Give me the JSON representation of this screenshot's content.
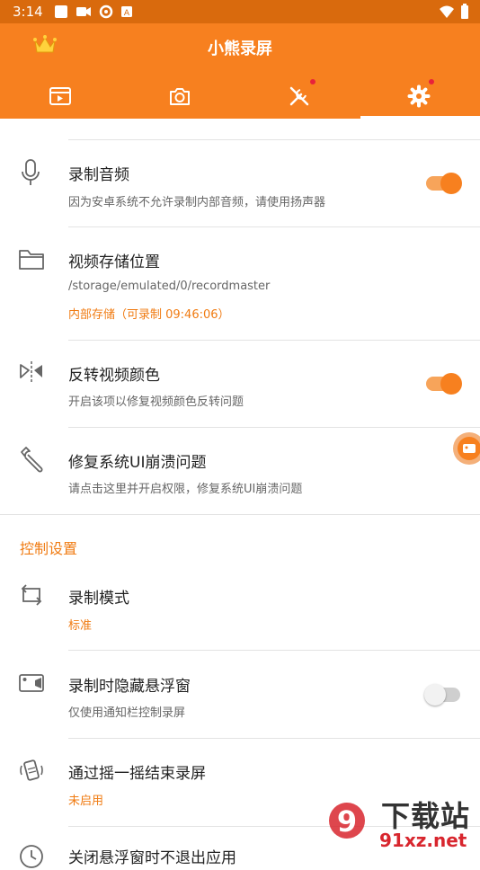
{
  "status_bar": {
    "time": "3:14"
  },
  "app": {
    "title": "小熊录屏"
  },
  "tabs": [
    {
      "icon": "video-list-icon",
      "has_dot": false
    },
    {
      "icon": "camera-icon",
      "has_dot": false
    },
    {
      "icon": "tools-icon",
      "has_dot": true
    },
    {
      "icon": "gear-icon",
      "has_dot": true,
      "selected": true
    }
  ],
  "settings": [
    {
      "icon": "microphone-icon",
      "title": "录制音频",
      "subtitle": "因为安卓系统不允许录制内部音频，请使用扬声器",
      "toggle": true
    },
    {
      "icon": "folder-icon",
      "title": "视频存储位置",
      "subtitle": "/storage/emulated/0/recordmaster",
      "extra": "内部存储（可录制 09:46:06）"
    },
    {
      "icon": "flip-icon",
      "title": "反转视频颜色",
      "subtitle": "开启该项以修复视频颜色反转问题",
      "toggle": true
    },
    {
      "icon": "wrench-icon",
      "title": "修复系统UI崩溃问题",
      "subtitle": "请点击这里并开启权限，修复系统UI崩溃问题"
    }
  ],
  "control_section": {
    "header": "控制设置",
    "items": [
      {
        "icon": "repeat-icon",
        "title": "录制模式",
        "subtitle": "标准"
      },
      {
        "icon": "floating-window-icon",
        "title": "录制时隐藏悬浮窗",
        "subtitle": "仅使用通知栏控制录屏",
        "toggle": false
      },
      {
        "icon": "shake-icon",
        "title": "通过摇一摇结束录屏",
        "subtitle": "未启用"
      },
      {
        "icon": "clock-icon",
        "title": "关闭悬浮窗时不退出应用"
      }
    ]
  },
  "watermark": {
    "brand": "下载站",
    "domain": "91xz.net",
    "logo_text": "9"
  },
  "colors": {
    "accent": "#f7801f",
    "status_bar": "#d96a0d",
    "notification_dot": "#e8223a"
  }
}
